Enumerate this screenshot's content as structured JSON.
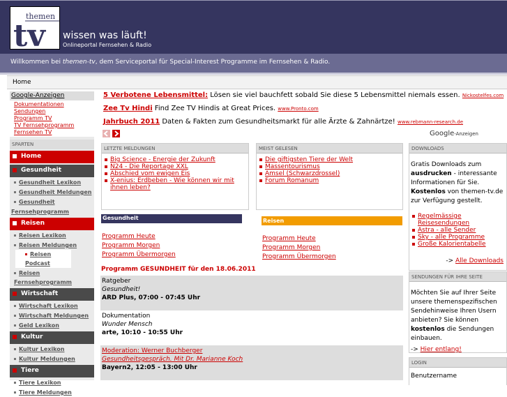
{
  "header": {
    "logo_top": "themen",
    "logo_main": "tv",
    "slogan": "wissen was läuft!",
    "subslogan": "Onlineportal Fernsehen & Radio",
    "welcome_pre": "Willkommen bei ",
    "welcome_brand": "themen-tv",
    "welcome_post": ", dem Serviceportal für Special-Interest Programme im Fernsehen & Radio."
  },
  "breadcrumb": "Home",
  "sidebar": {
    "google_ads_label": "Google-Anzeigen",
    "google_ads_links": [
      "Dokumentationen",
      "Sendungen",
      "Programm TV",
      "TV Fernsehprogramm",
      "Fernsehen TV"
    ],
    "sparten_label": "SPARTEN",
    "home": "Home",
    "gesundheit": "Gesundheit",
    "gesundheit_subs": [
      "Gesundheit Lexikon",
      "Gesundheit Meldungen",
      "Gesundheit",
      "Fernsehprogramm"
    ],
    "reisen": "Reisen",
    "reisen_subs": [
      "Reisen Lexikon",
      "Reisen Meldungen"
    ],
    "reisen_podcast": "Reisen Podcast",
    "reisen_fernseh": "Reisen Fernsehprogramm",
    "wirtschaft": "Wirtschaft",
    "wirtschaft_subs": [
      "Wirtschaft Lexikon",
      "Wirtschaft Meldungen",
      "Geld Lexikon"
    ],
    "kultur": "Kultur",
    "kultur_subs": [
      "Kultur Lexikon",
      "Kultur Meldungen"
    ],
    "tiere": "Tiere",
    "tiere_subs": [
      "Tiere Lexikon",
      "Tiere Meldungen"
    ]
  },
  "ads": [
    {
      "title": "5 Verbotene Lebensmittel:",
      "text": " Lösen sie viel bauchfett sobald Sie diese 5 Lebensmittel niemals essen. ",
      "url": "Nickostelfes.com"
    },
    {
      "title": "Zee Tv Hindi",
      "text": " Find Zee TV Hindis at Great Prices. ",
      "url": "www.Pronto.com"
    },
    {
      "title": "Jahrbuch 2011",
      "text": " Daten & Fakten zum Gesundheitsmarkt für alle Ärzte & Zahnärtze! ",
      "url": "www.rebmann-research.de"
    }
  ],
  "google_ads_label": "Google",
  "google_ads_suffix": "-Anzeigen",
  "letzte": {
    "title": "LETZTE MELDUNGEN",
    "items": [
      "Big Science - Energie der Zukunft",
      "N24 - Die Reportage XXL",
      "Abschied vom ewigen Eis",
      "X-enius: Erdbeben - Wie können wir mit ihnen leben?"
    ]
  },
  "meist": {
    "title": "MEIST GELESEN",
    "items": [
      "Die giftigsten Tiere der Welt",
      "Massentourismus",
      "Amsel (Schwarzdrossel)",
      "Forum Romanum"
    ]
  },
  "gesundheit": {
    "title": "Gesundheit",
    "links": [
      "Programm Heute",
      "Programm Morgen",
      "Programm Übermorgen"
    ],
    "program_title": "Programm GESUNDHEIT für den 18.06.2011"
  },
  "reisen": {
    "title": "Reisen",
    "links": [
      "Programm Heute",
      "Programm Morgen",
      "Programm Übermorgen"
    ]
  },
  "entries": [
    {
      "cat": "Ratgeber",
      "show": "Gesundheit!",
      "time": "ARD Plus, 07:00 - 07:45 Uhr"
    },
    {
      "cat": "Dokumentation",
      "show": "Wunder Mensch",
      "time": "arte, 10:10 - 10:55 Uhr"
    },
    {
      "cat": "Moderation: Werner Buchberger",
      "show": "Gesundheitsgespräch. Mit Dr. Marianne Koch",
      "time": "Bayern2, 12:05 - 13:00 Uhr"
    }
  ],
  "downloads": {
    "title": "DOWNLOADS",
    "text1": "Gratis Downloads zum ",
    "bold1": "ausdrucken",
    "text2": " - interessante Informationen für Sie. ",
    "bold2": "Kostenlos",
    "text3": " von themen-tv.de zur Verfügung gestellt.",
    "items": [
      "Regelmässige Reisesendungen",
      "Astra - alle Sender",
      "Sky - alle Programme",
      "Große Kalorientabelle"
    ],
    "all_prefix": "-> ",
    "all_link": "Alle Downloads"
  },
  "sendungen": {
    "title": "SENDUNGEN FÜR IHRE SEITE",
    "text1": "Möchten Sie auf Ihrer Seite unsere themenspezifischen Sendehinweise Ihren Usern anbieten? Sie können ",
    "bold": "kostenlos",
    "text2": " die Sendungen einbauen.",
    "link_prefix": "-> ",
    "link": "Hier entlang!"
  },
  "login": {
    "title": "LOGIN",
    "user_label": "Benutzername"
  },
  "colors": {
    "header": "#35355f",
    "accent_red": "#cc0000",
    "reisen_orange": "#f29c00"
  }
}
